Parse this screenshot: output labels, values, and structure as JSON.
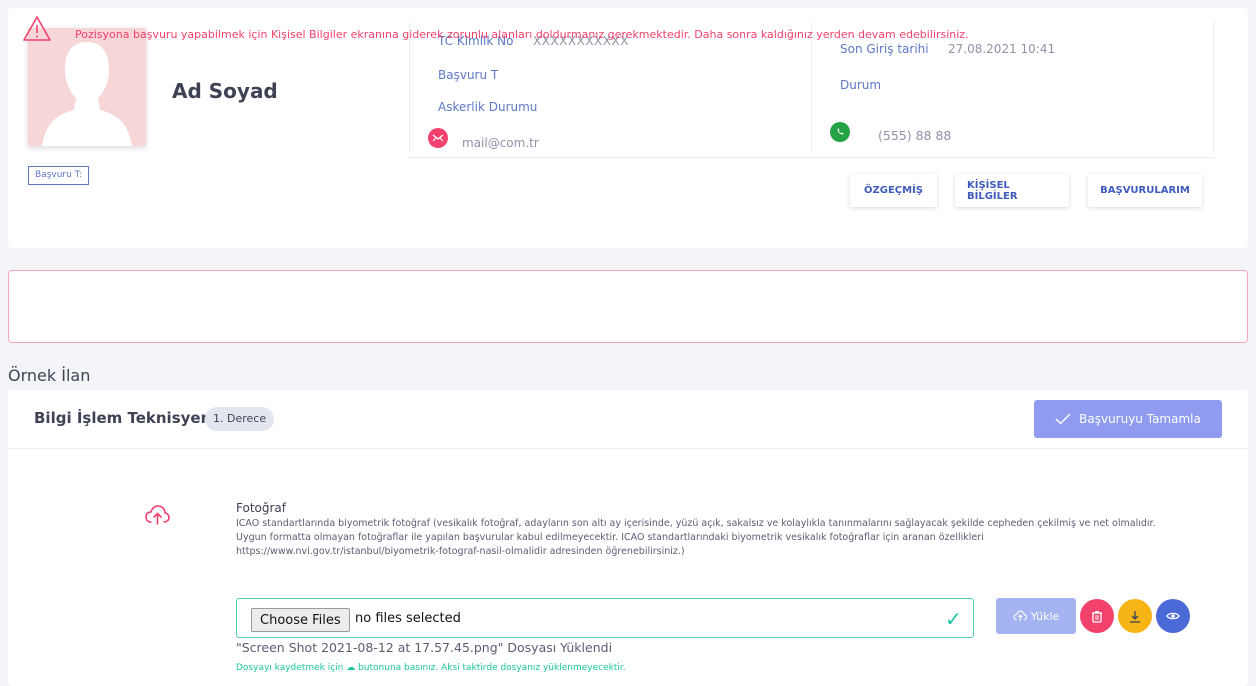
{
  "profile": {
    "name": "Ad Soyad",
    "tc_label": "TC Kimlik No",
    "tc_value": "XXXXXXXXXXX",
    "basvuru_label": "Başvuru T",
    "askerlik_label": "Askerlik Durumu",
    "email": "mail@com.tr",
    "last_login_label": "Son Giriş tarihi",
    "last_login_value": "27.08.2021 10:41",
    "durum_label": "Durum",
    "phone": "(555) 88 88",
    "tag": "Başvuru T:"
  },
  "tabs": [
    {
      "label": "ÖZGEÇMİŞ"
    },
    {
      "label": "KİŞİSEL BİLGİLER"
    },
    {
      "label": "BAŞVURULARIM"
    }
  ],
  "alert": {
    "text": "Pozisyona başvuru yapabilmek için Kişisel Bilgiler ekranına giderek zorunlu alanları doldurmanız gerekmektedir. Daha sonra kaldığınız yerden devam edebilirsiniz."
  },
  "section_title": "Örnek İlan",
  "listing": {
    "title": "Bilgi İşlem Teknisyen",
    "degree": "1. Derece",
    "complete_label": "Başvuruyu Tamamla"
  },
  "upload": {
    "label": "Fotoğraf",
    "description": "ICAO standartlarında biyometrik fotoğraf (vesikalık fotoğraf, adayların son altı ay içerisinde, yüzü açık, sakalsız ve kolaylıkla tanınmalarını sağlayacak şekilde cepheden çekilmiş ve net olmalıdır. Uygun formatta olmayan fotoğraflar ile yapılan başvurular kabul edilmeyecektir. ICAO standartlarındaki biyometrik vesikalık fotoğraflar için aranan özellikleri https://www.nvi.gov.tr/istanbul/biyometrik-fotograf-nasil-olmalidir adresinden öğrenebilirsiniz.)",
    "choose_label": "Choose Files",
    "no_files": "no files selected",
    "upload_btn": "Yükle",
    "uploaded_text": "\"Screen Shot 2021-08-12 at 17.57.45.png\" Dosyası Yüklendi",
    "hint": "Dosyayı kaydetmek için ☁ butonuna basınız. Aksi taktirde dosyanız yüklenmeyecektir."
  },
  "colors": {
    "primary": "#3f5bbd",
    "danger": "#f1416c",
    "success": "#1bc5a0",
    "warning": "#f6b416",
    "whatsapp": "#25a244"
  }
}
